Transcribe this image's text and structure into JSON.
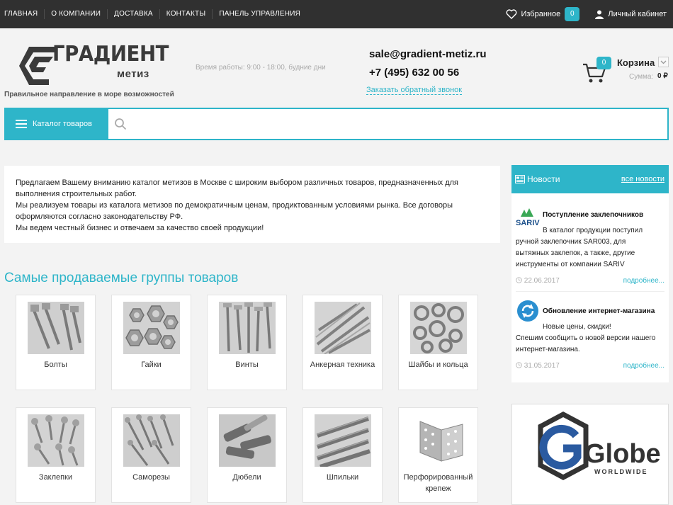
{
  "topnav": [
    "ГЛАВНАЯ",
    "О КОМПАНИИ",
    "ДОСТАВКА",
    "КОНТАКТЫ",
    "ПАНЕЛЬ УПРАВЛЕНИЯ"
  ],
  "favorites": {
    "label": "Избранное",
    "count": "0"
  },
  "cabinet": {
    "label": "Личный кабинет"
  },
  "logo": {
    "title": "ГРАДИЕНТ",
    "sub": "метиз"
  },
  "tagline": "Правильное направление в море возможностей",
  "worktime": "Время работы: 9:00 - 18:00, будние дни",
  "contacts": {
    "email": "sale@gradient-metiz.ru",
    "phone": "+7 (495) 632 00 56",
    "callback": "Заказать обратный звонок"
  },
  "cart": {
    "count": "0",
    "label": "Корзина",
    "sum_label": "Сумма:",
    "sum": "0 ₽"
  },
  "search": {
    "catalog_label": "Каталог товаров",
    "placeholder": ""
  },
  "intro": {
    "line1": "Предлагаем Вашему вниманию каталог метизов в Москве с широким выбором различных товаров, предназначенных для",
    "line2": "выполнения строительных работ.",
    "line3": "Мы реализуем товары из каталога метизов по демократичным ценам, продиктованным условиями рынка. Все договоры",
    "line4": "оформляются согласно законодательству РФ.",
    "line5": "Мы ведем честный бизнес и отвечаем за качество своей продукции!"
  },
  "section_title": "Самые продаваемые группы товаров",
  "categories": [
    {
      "name": "Болты",
      "icon": "bolts-image"
    },
    {
      "name": "Гайки",
      "icon": "nuts-image"
    },
    {
      "name": "Винты",
      "icon": "screws-image"
    },
    {
      "name": "Анкерная техника",
      "icon": "anchors-image"
    },
    {
      "name": "Шайбы и кольца",
      "icon": "washers-image"
    },
    {
      "name": "Заклепки",
      "icon": "rivets-image"
    },
    {
      "name": "Саморезы",
      "icon": "self-tapping-screws-image"
    },
    {
      "name": "Дюбели",
      "icon": "dowels-image"
    },
    {
      "name": "Шпильки",
      "icon": "studs-image"
    },
    {
      "name": "Перфорированный крепеж",
      "icon": "perforated-fasteners-image"
    }
  ],
  "news": {
    "title": "Новости",
    "all_link": "все новости",
    "items": [
      {
        "logo_text": "SARIV",
        "title": "Поступление заклепочников",
        "l1": "В каталог продукции поступил",
        "l2": "ручной заклепочник SAR003, для",
        "l3": "вытяжных заклепок, а также, другие",
        "l4": "инструменты от компании SARIV",
        "date": "22.06.2017",
        "more": "подробнее..."
      },
      {
        "title": "Обновление интернет-магазина",
        "l1": "Новые цены, скидки!",
        "l2": "Спешим сообщить о новой версии нашего",
        "l3": "интернет-магазина.",
        "date": "31.05.2017",
        "more": "подробнее..."
      }
    ]
  },
  "banner": {
    "brand": "Globex",
    "sub": "WORLDWIDE"
  },
  "colors": {
    "accent": "#2eb5c9",
    "topbar": "#303030"
  }
}
